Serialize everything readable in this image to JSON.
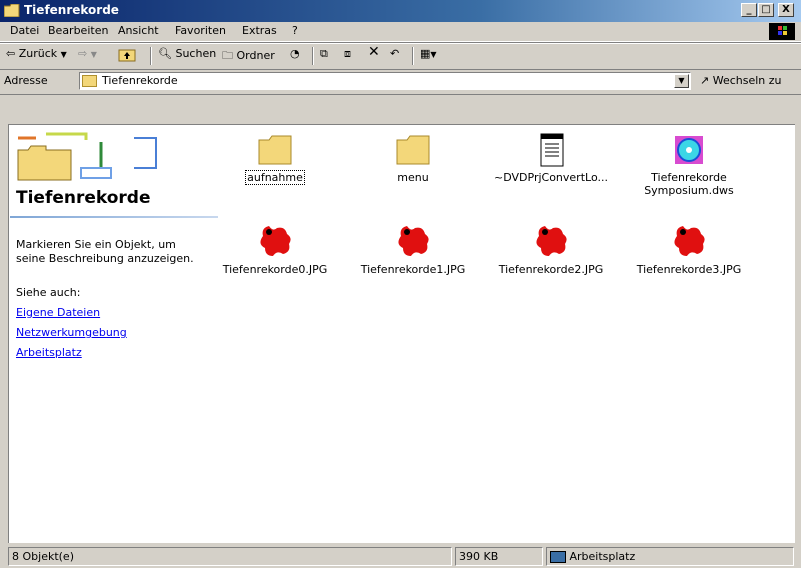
{
  "window": {
    "title": "Tiefenrekorde",
    "min_label": "_",
    "max_label": "□",
    "close_label": "X"
  },
  "menu": [
    "Datei",
    "Bearbeiten",
    "Ansicht",
    "Favoriten",
    "Extras",
    "?"
  ],
  "toolbar": {
    "back_label": "Zurück",
    "search_label": "Suchen",
    "folders_label": "Ordner"
  },
  "address": {
    "label": "Adresse",
    "value": "Tiefenrekorde",
    "go_label": "Wechseln zu"
  },
  "panel": {
    "title": "Tiefenrekorde",
    "hint_line1": "Markieren Sie ein Objekt, um",
    "hint_line2": "seine Beschreibung anzuzeigen.",
    "see_also": "Siehe auch:",
    "links": [
      "Eigene Dateien",
      "Netzwerkumgebung",
      "Arbeitsplatz"
    ]
  },
  "files": [
    {
      "name": "aufnahme",
      "icon": "folder-icon"
    },
    {
      "name": "menu",
      "icon": "folder-icon"
    },
    {
      "name": "~DVDPrjConvertLo...",
      "icon": "text-file-icon"
    },
    {
      "name_line1": "Tiefenrekorde",
      "name_line2": "Symposium.dws",
      "icon": "dvd-project-icon"
    },
    {
      "name": "Tiefenrekorde0.JPG",
      "icon": "jpg-image-icon"
    },
    {
      "name": "Tiefenrekorde1.JPG",
      "icon": "jpg-image-icon"
    },
    {
      "name": "Tiefenrekorde2.JPG",
      "icon": "jpg-image-icon"
    },
    {
      "name": "Tiefenrekorde3.JPG",
      "icon": "jpg-image-icon"
    }
  ],
  "status": {
    "count": "8 Objekt(e)",
    "size": "390 KB",
    "zone": "Arbeitsplatz"
  }
}
